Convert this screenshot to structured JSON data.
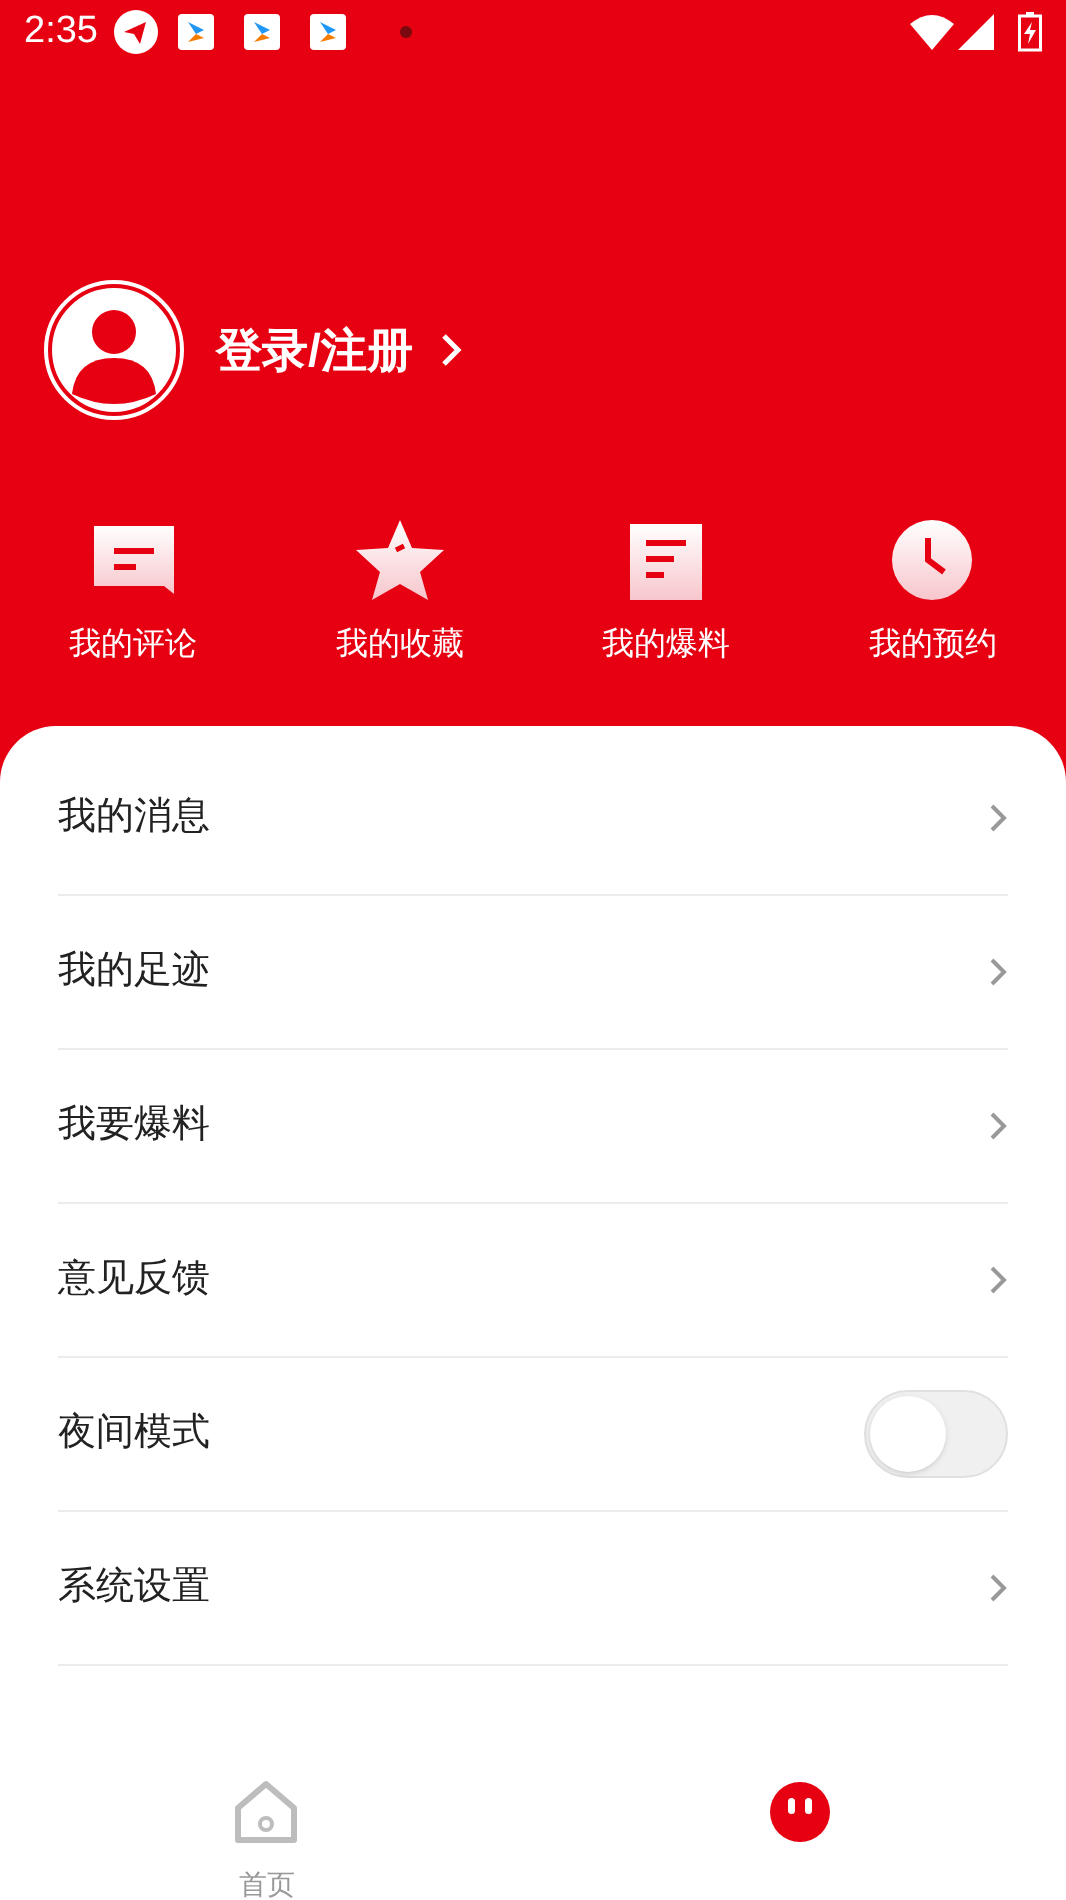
{
  "status_bar": {
    "time": "2:35"
  },
  "profile": {
    "login_label": "登录/注册"
  },
  "shortcuts": [
    {
      "kind": "comment",
      "label": "我的评论"
    },
    {
      "kind": "star",
      "label": "我的收藏"
    },
    {
      "kind": "document",
      "label": "我的爆料"
    },
    {
      "kind": "clock",
      "label": "我的预约"
    }
  ],
  "menu": [
    {
      "kind": "link",
      "label": "我的消息"
    },
    {
      "kind": "link",
      "label": "我的足迹"
    },
    {
      "kind": "link",
      "label": "我要爆料"
    },
    {
      "kind": "link",
      "label": "意见反馈"
    },
    {
      "kind": "toggle",
      "label": "夜间模式",
      "on": false
    },
    {
      "kind": "link",
      "label": "系统设置"
    }
  ],
  "bottom_nav": [
    {
      "kind": "home",
      "label": "首页",
      "selected": false
    },
    {
      "kind": "face",
      "selected": true
    }
  ]
}
